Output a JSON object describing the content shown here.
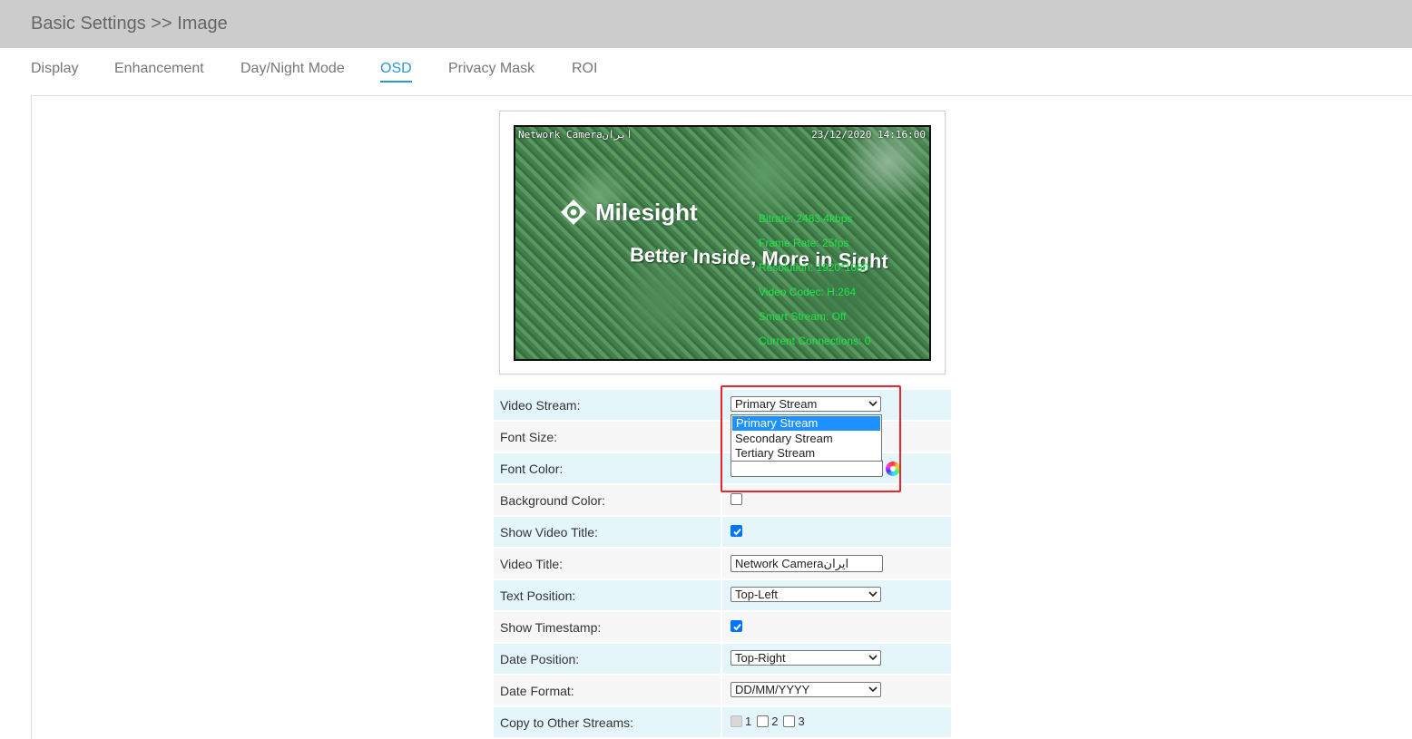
{
  "header": {
    "title": "Basic Settings >> Image"
  },
  "tabs": [
    {
      "label": "Display"
    },
    {
      "label": "Enhancement"
    },
    {
      "label": "Day/Night Mode"
    },
    {
      "label": "OSD",
      "active": true
    },
    {
      "label": "Privacy Mask"
    },
    {
      "label": "ROI"
    }
  ],
  "preview": {
    "overlay_title": "Network Cameraایران",
    "overlay_date": "23/12/2020 14:16:00",
    "logo_text": "Milesight",
    "slogan": "Better Inside, More in Sight",
    "stats": [
      "Bitrate: 2483.4kbps",
      "Frame Rate: 25fps",
      "Resolution: 1920*1080",
      "Video Codec: H.264",
      "Smart Stream: Off",
      "Current Connections: 0"
    ]
  },
  "form": {
    "video_stream": {
      "label": "Video Stream:",
      "value": "Primary Stream",
      "options": [
        "Primary Stream",
        "Secondary Stream",
        "Tertiary Stream"
      ]
    },
    "font_size": {
      "label": "Font Size:"
    },
    "font_color": {
      "label": "Font Color:",
      "value": ""
    },
    "background_color": {
      "label": "Background Color:",
      "checked": false
    },
    "show_video_title": {
      "label": "Show Video Title:",
      "checked": true
    },
    "video_title": {
      "label": "Video Title:",
      "value": "Network Cameraایران"
    },
    "text_position": {
      "label": "Text Position:",
      "value": "Top-Left"
    },
    "show_timestamp": {
      "label": "Show Timestamp:",
      "checked": true
    },
    "date_position": {
      "label": "Date Position:",
      "value": "Top-Right"
    },
    "date_format": {
      "label": "Date Format:",
      "value": "DD/MM/YYYY"
    },
    "copy_to_streams": {
      "label": "Copy to Other Streams:",
      "items": [
        "1",
        "2",
        "3"
      ]
    }
  },
  "colors": {
    "accent": "#2a98d8",
    "highlight_border": "#e8252a",
    "osd_stats": "#1ee64a"
  }
}
